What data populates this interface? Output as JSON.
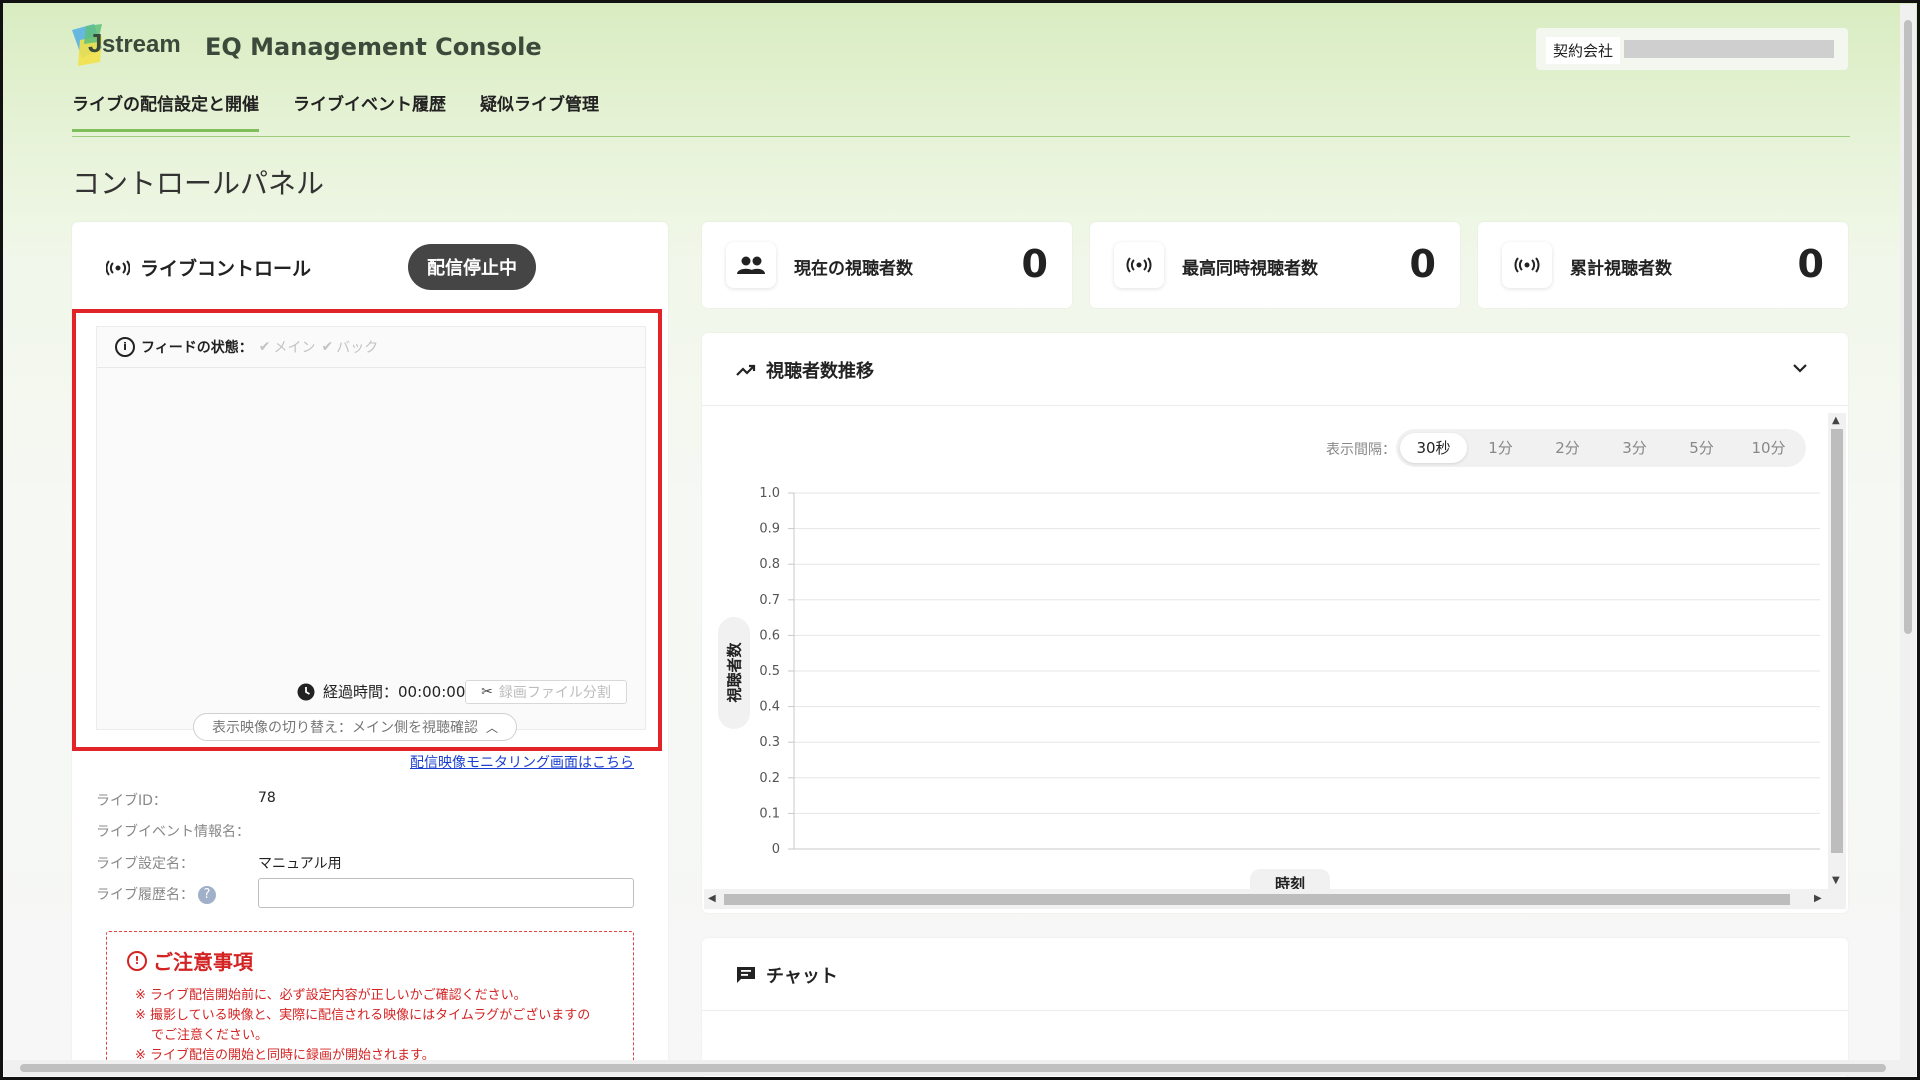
{
  "header": {
    "logo_text": "Jstream",
    "app_title": "EQ Management Console",
    "company_label": "契約会社"
  },
  "nav": {
    "items": [
      "ライブの配信設定と開催",
      "ライブイベント履歴",
      "疑似ライブ管理"
    ],
    "active_index": 0
  },
  "page_title": "コントロールパネル",
  "live_control": {
    "title": "ライブコントロール",
    "status": "配信停止中",
    "feed_label": "フィードの状態：",
    "feed_main": "メイン",
    "feed_back": "バック",
    "elapsed_label": "経過時間：00:00:00",
    "split_button": "録画ファイル分割",
    "switch_label": "表示映像の切り替え：メイン側を視聴確認",
    "monitor_link": "配信映像モニタリング画面はこちら",
    "info": {
      "live_id_label": "ライブID：",
      "live_id_value": "78",
      "event_name_label": "ライブイベント情報名：",
      "event_name_value": "",
      "setting_name_label": "ライブ設定名：",
      "setting_name_value": "マニュアル用",
      "history_name_label": "ライブ履歴名：",
      "history_name_value": ""
    },
    "caution": {
      "title": "ご注意事項",
      "lines": [
        "※ ライブ配信開始前に、必ず設定内容が正しいかご確認ください。",
        "※ 撮影している映像と、実際に配信される映像にはタイムラグがございますの",
        "でご注意ください。",
        "※ ライブ配信の開始と同時に録画が開始されます。"
      ]
    }
  },
  "stats": [
    {
      "label": "現在の視聴者数",
      "value": "0",
      "icon": "people-icon"
    },
    {
      "label": "最高同時視聴者数",
      "value": "0",
      "icon": "broadcast-icon"
    },
    {
      "label": "累計視聴者数",
      "value": "0",
      "icon": "broadcast-icon"
    }
  ],
  "viewer_chart": {
    "title": "視聴者数推移",
    "interval_label": "表示間隔：",
    "intervals": [
      "30秒",
      "1分",
      "2分",
      "3分",
      "5分",
      "10分"
    ],
    "active_interval": 0
  },
  "chart_data": {
    "type": "line",
    "title": "",
    "xlabel": "時刻",
    "ylabel": "視聴者数",
    "x": [],
    "series": [],
    "ylim": [
      0,
      1.0
    ],
    "yticks": [
      "0",
      "0.1",
      "0.2",
      "0.3",
      "0.4",
      "0.5",
      "0.6",
      "0.7",
      "0.8",
      "0.9",
      "1.0"
    ],
    "grid": true
  },
  "chat": {
    "title": "チャット"
  },
  "colors": {
    "accent_green": "#7fbf5a",
    "status_pill": "#454545",
    "highlight_red": "#e02428",
    "caution_red": "#d42323",
    "link_blue": "#1a3fd0"
  }
}
